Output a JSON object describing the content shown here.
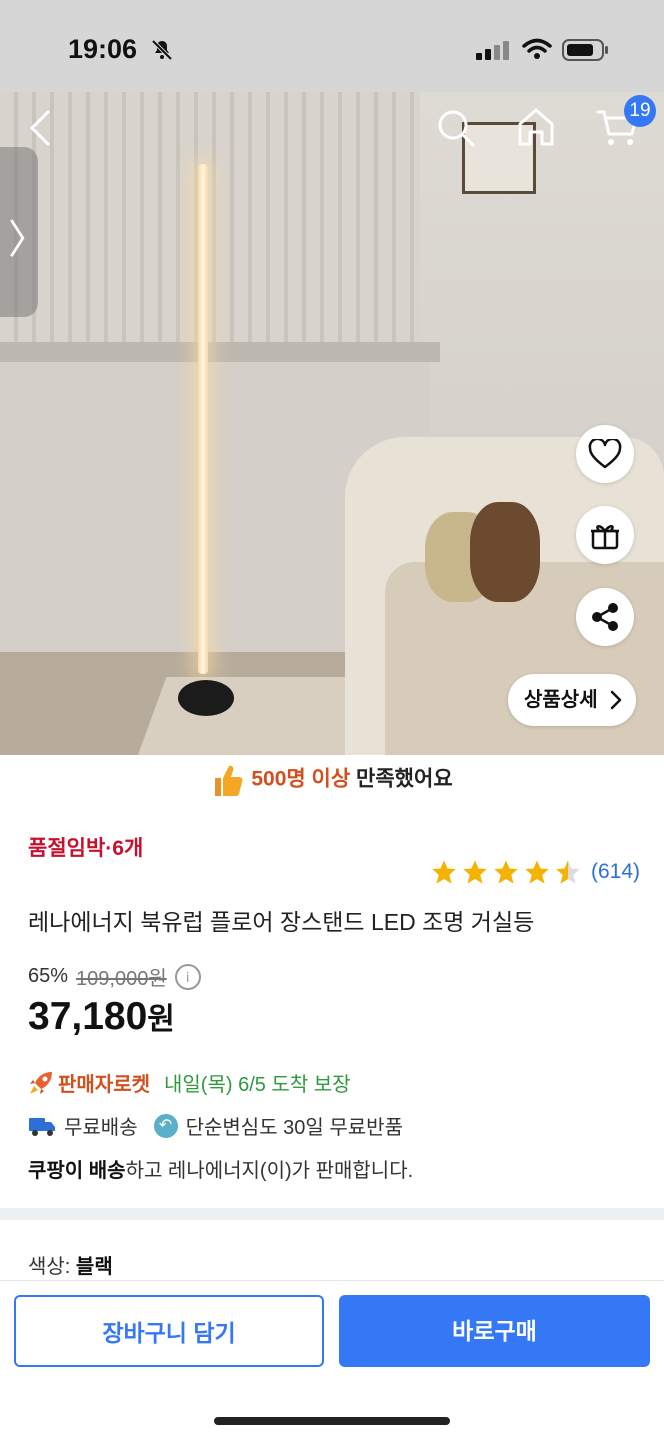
{
  "status_bar": {
    "time": "19:06",
    "icons": [
      "bell-slash-icon",
      "signal-icon",
      "wifi-icon",
      "battery-icon"
    ]
  },
  "header": {
    "cart_count": "19",
    "icons": [
      "back-icon",
      "search-icon",
      "home-icon",
      "cart-icon"
    ]
  },
  "hero": {
    "side_tab_glyph": "〉",
    "detail_button": "상품상세",
    "actions": [
      "heart-icon",
      "gift-icon",
      "share-icon"
    ]
  },
  "satisfaction": {
    "highlight": "500명 이상",
    "rest": " 만족했어요"
  },
  "product": {
    "stock_status": "품절임박·6개",
    "rating_stars": 4.5,
    "review_count": "(614)",
    "title": "레나에너지 북유럽 플로어 장스탠드 LED 조명 거실등",
    "discount_percent": "65%",
    "original_price": "109,000원",
    "info_glyph": "i",
    "price_number": "37,180",
    "price_unit": "원"
  },
  "delivery": {
    "rocket_label": "판매자로켓",
    "arrival": "내일(목) 6/5 도착 보장",
    "free_shipping": "무료배송",
    "free_return": "단순변심도 30일 무료반품",
    "seller_bold": "쿠팡이 배송",
    "seller_rest": "하고 레나에너지(이)가 판매합니다."
  },
  "option": {
    "label": "색상: ",
    "value": "블랙"
  },
  "actions": {
    "add_to_cart": "장바구니 담기",
    "buy_now": "바로구매"
  },
  "colors": {
    "accent_blue": "#3478f6",
    "stock_red": "#c8102e",
    "highlight_orange": "#d0501e",
    "arrival_green": "#2f9a3d",
    "star_gold": "#f5b301"
  }
}
